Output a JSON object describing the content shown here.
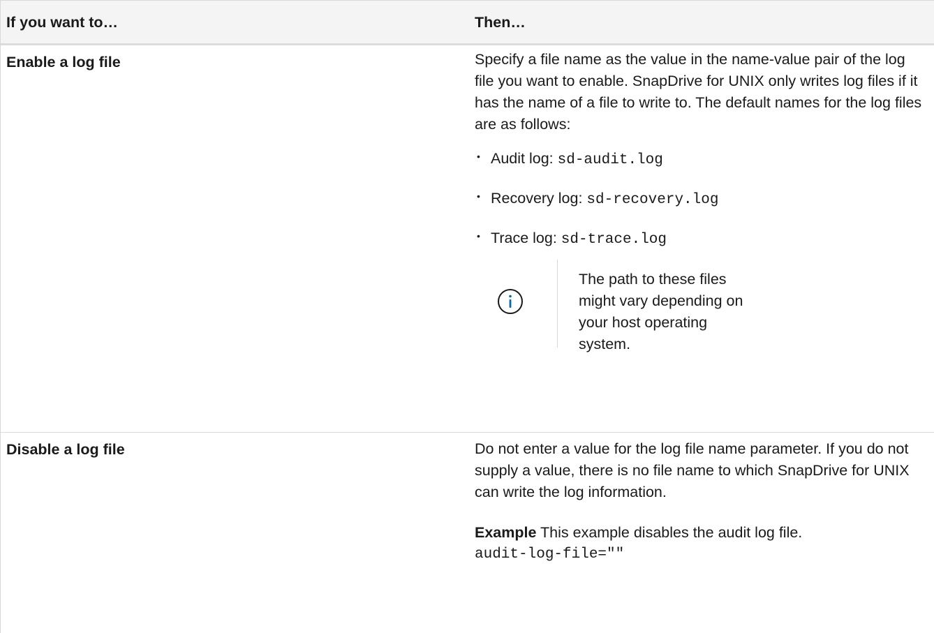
{
  "table": {
    "headers": {
      "col1": "If you want to…",
      "col2": "Then…"
    },
    "rows": [
      {
        "label": "Enable a log file",
        "intro": "Specify a file name as the value in the name-value pair of the log file you want to enable. SnapDrive for UNIX only writes log files if it has the name of a file to write to. The default names for the log files are as follows:",
        "bullets": [
          {
            "text": "Audit log: ",
            "code": "sd-audit.log"
          },
          {
            "text": "Recovery log: ",
            "code": "sd-recovery.log"
          },
          {
            "text": "Trace log: ",
            "code": "sd-trace.log"
          }
        ],
        "note": {
          "icon": "info-icon",
          "text": "The path to these files might vary depending on your host operating system."
        }
      },
      {
        "label": "Disable a log file",
        "intro": "Do not enter a value for the log file name parameter. If you do not supply a value, there is no file name to which SnapDrive for UNIX can write the log information.",
        "example_label": "Example",
        "example_text": " This example disables the audit log file.",
        "example_code": "audit-log-file=\"\""
      }
    ]
  },
  "colors": {
    "header_bg": "#f4f4f4",
    "border": "#d8d8d8",
    "info_icon": "#0b67a8"
  }
}
